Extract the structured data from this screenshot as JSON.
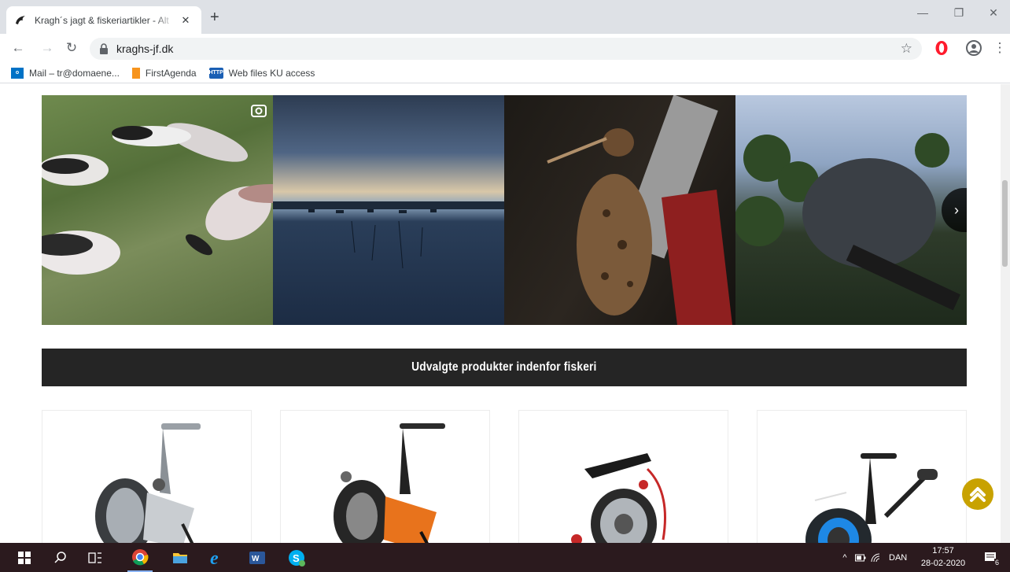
{
  "browser": {
    "tab_title": "Kragh´s jagt & fiskeriartikler - Alt",
    "tab_close": "✕",
    "new_tab": "+",
    "url": "kraghs-jf.dk",
    "window_controls": {
      "minimize": "—",
      "restore": "❐",
      "close": "✕"
    },
    "nav": {
      "back": "←",
      "forward": "→",
      "reload": "↻"
    },
    "star": "☆",
    "menu": "⋮",
    "bookmarks": [
      {
        "label": "Mail – tr@domaene...",
        "icon": "outlook-icon"
      },
      {
        "label": "FirstAgenda",
        "icon": "firstagenda-icon"
      },
      {
        "label": "Web files KU access",
        "icon": "http-icon",
        "icon_text": "HTTP"
      }
    ]
  },
  "page": {
    "gallery": {
      "photos": [
        "geese-on-grass",
        "lake-at-dusk",
        "woodcock-with-shotgun",
        "bird-on-branch"
      ],
      "next_label": "›"
    },
    "section_title": "Udvalgte produkter indenfor fiskeri",
    "products": [
      {
        "image": "spinning-reel-silver",
        "accent": "#9aa0a6"
      },
      {
        "image": "spinning-reel-orange",
        "accent": "#e8731c"
      },
      {
        "image": "spinning-reel-red",
        "accent": "#c62828"
      },
      {
        "image": "spinning-reel-blue",
        "accent": "#1e88e5"
      }
    ]
  },
  "taskbar": {
    "language": "DAN",
    "time": "17:57",
    "date": "28-02-2020",
    "notification_count": "6"
  },
  "colors": {
    "banner": "#252525",
    "back_to_top": "#c8a200",
    "taskbar": "#2b1a1e"
  }
}
